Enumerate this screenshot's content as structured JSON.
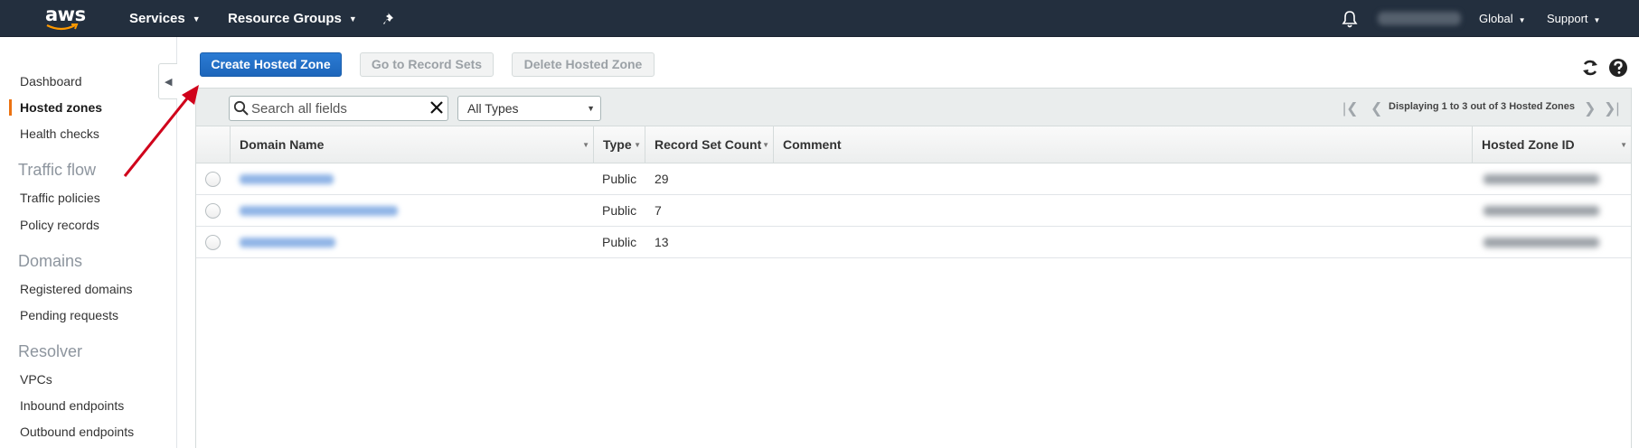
{
  "topnav": {
    "logo": "aws",
    "services": "Services",
    "resource_groups": "Resource Groups",
    "region": "Global",
    "support": "Support"
  },
  "sidebar": {
    "items": [
      {
        "label": "Dashboard"
      },
      {
        "label": "Hosted zones",
        "active": true
      },
      {
        "label": "Health checks"
      }
    ],
    "sections": [
      {
        "heading": "Traffic flow",
        "items": [
          "Traffic policies",
          "Policy records"
        ]
      },
      {
        "heading": "Domains",
        "items": [
          "Registered domains",
          "Pending requests"
        ]
      },
      {
        "heading": "Resolver",
        "items": [
          "VPCs",
          "Inbound endpoints",
          "Outbound endpoints"
        ]
      }
    ]
  },
  "toolbar": {
    "create": "Create Hosted Zone",
    "goto": "Go to Record Sets",
    "delete": "Delete Hosted Zone"
  },
  "filter": {
    "search_placeholder": "Search all fields",
    "type_select": "All Types",
    "pager_text": "Displaying 1 to 3 out of 3 Hosted Zones"
  },
  "table": {
    "columns": [
      "Domain Name",
      "Type",
      "Record Set Count",
      "Comment",
      "Hosted Zone ID"
    ],
    "rows": [
      {
        "type": "Public",
        "count": "29"
      },
      {
        "type": "Public",
        "count": "7"
      },
      {
        "type": "Public",
        "count": "13"
      }
    ]
  },
  "colors": {
    "nav_bg": "#232f3e",
    "primary": "#1d66bb",
    "active_indicator": "#ec7211",
    "annotation": "#d0021b"
  },
  "icons": [
    "aws-smile-icon",
    "pin-icon",
    "bell-icon",
    "collapse-icon",
    "refresh-icon",
    "help-icon",
    "search-icon",
    "clear-icon",
    "first-page-icon",
    "prev-page-icon",
    "next-page-icon",
    "last-page-icon"
  ]
}
